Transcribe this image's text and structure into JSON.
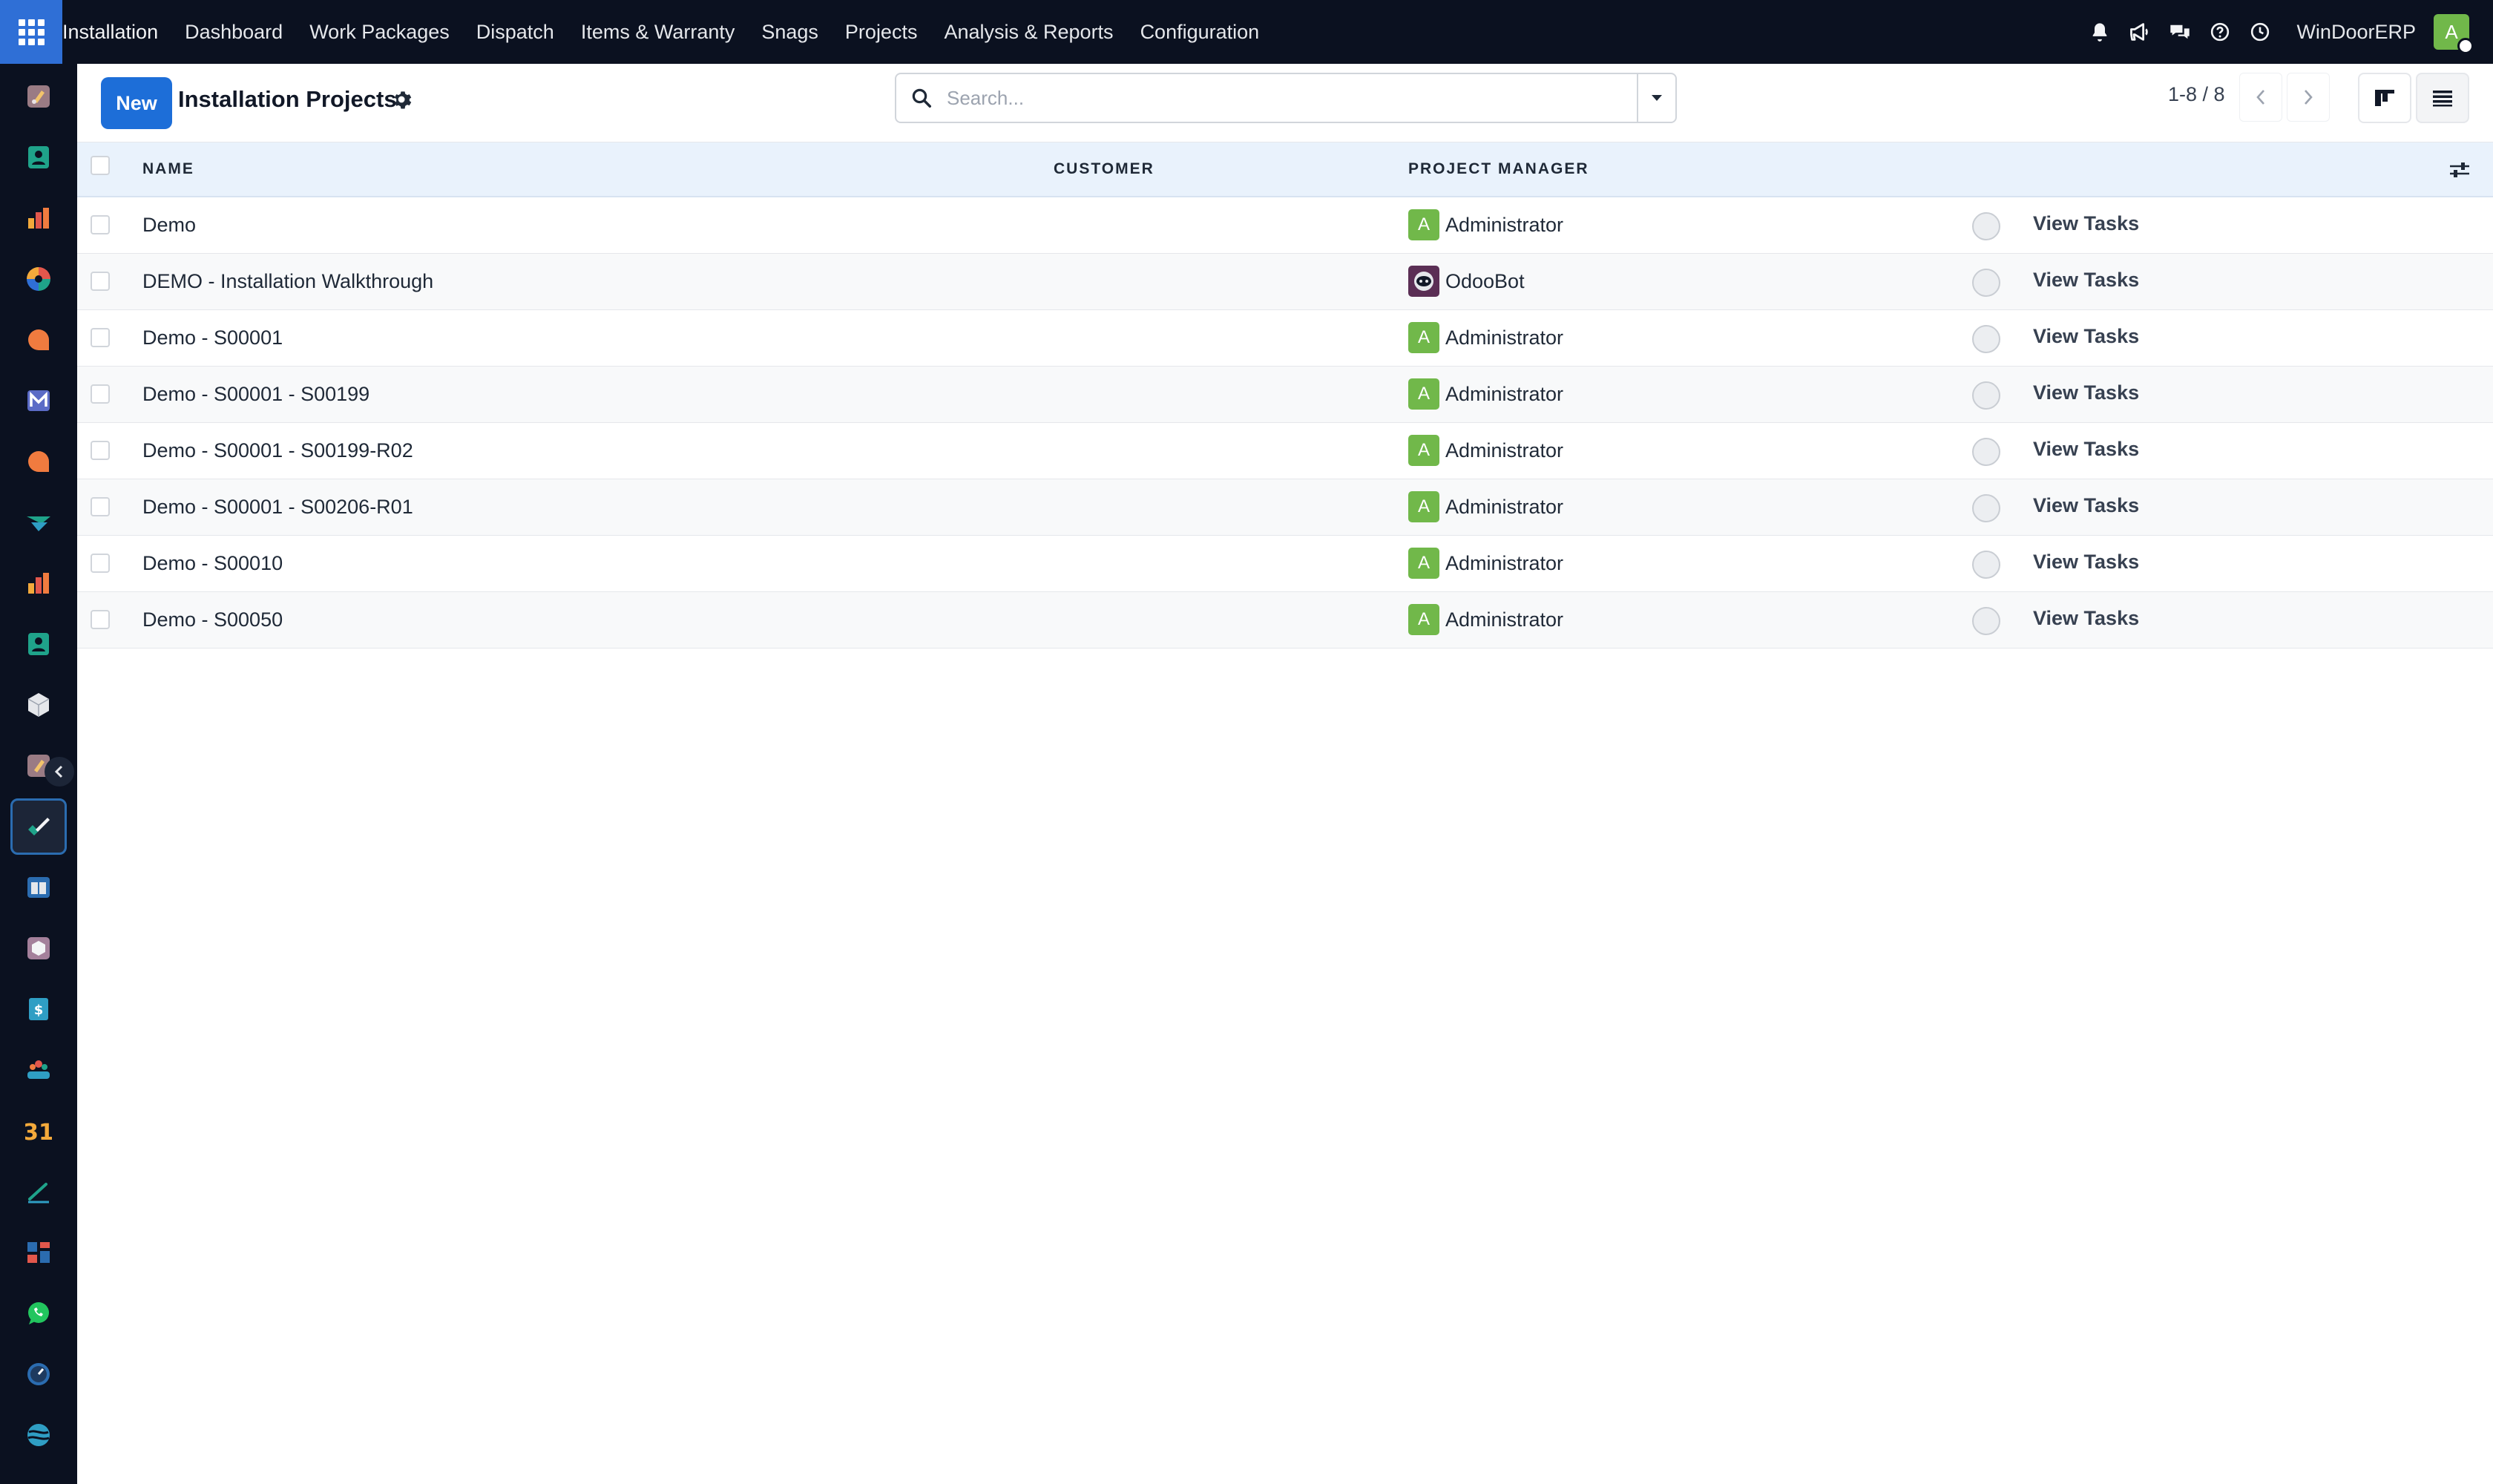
{
  "topbar": {
    "apps_icon": "apps-grid-icon",
    "menu": [
      {
        "label": "Installation",
        "brand": true
      },
      {
        "label": "Dashboard"
      },
      {
        "label": "Work Packages"
      },
      {
        "label": "Dispatch"
      },
      {
        "label": "Items & Warranty"
      },
      {
        "label": "Snags"
      },
      {
        "label": "Projects"
      },
      {
        "label": "Analysis & Reports"
      },
      {
        "label": "Configuration"
      }
    ],
    "tray_icons": [
      "bell-icon",
      "megaphone-icon",
      "chat-icon",
      "help-icon",
      "clock-icon"
    ],
    "company": "WinDoorERP",
    "user_initial": "A",
    "user_color": "#71b84a"
  },
  "rail": {
    "items": [
      "discuss-app-icon",
      "contacts-app-icon",
      "sales-app-icon",
      "crm-app-icon",
      "livechat-app-icon",
      "email-marketing-app-icon",
      "chat-app-icon",
      "planning-app-icon",
      "reports-app-icon",
      "employees-app-icon",
      "inventory-app-icon",
      "field-service-app-icon",
      "installation-app-icon",
      "knowledge-app-icon",
      "product-app-icon",
      "accounting-app-icon",
      "team-app-icon",
      "calendar-app-icon",
      "sign-app-icon",
      "dashboard-app-icon",
      "whatsapp-app-icon",
      "timer-app-icon",
      "website-app-icon"
    ],
    "active_index": 12,
    "calendar_label": "31"
  },
  "control_panel": {
    "new_label": "New",
    "title": "Installation Projects",
    "search_placeholder": "Search...",
    "pager": "1-8 / 8"
  },
  "list": {
    "columns": {
      "name": "NAME",
      "customer": "CUSTOMER",
      "project_manager": "PROJECT MANAGER"
    },
    "rows": [
      {
        "name": "Demo",
        "customer": "",
        "manager": "Administrator",
        "manager_initial": "A",
        "manager_is_bot": false,
        "action": "View Tasks"
      },
      {
        "name": "DEMO - Installation Walkthrough",
        "customer": "",
        "manager": "OdooBot",
        "manager_initial": "",
        "manager_is_bot": true,
        "action": "View Tasks"
      },
      {
        "name": "Demo - S00001",
        "customer": "",
        "manager": "Administrator",
        "manager_initial": "A",
        "manager_is_bot": false,
        "action": "View Tasks"
      },
      {
        "name": "Demo - S00001 - S00199",
        "customer": "",
        "manager": "Administrator",
        "manager_initial": "A",
        "manager_is_bot": false,
        "action": "View Tasks"
      },
      {
        "name": "Demo - S00001 - S00199-R02",
        "customer": "",
        "manager": "Administrator",
        "manager_initial": "A",
        "manager_is_bot": false,
        "action": "View Tasks"
      },
      {
        "name": "Demo - S00001 - S00206-R01",
        "customer": "",
        "manager": "Administrator",
        "manager_initial": "A",
        "manager_is_bot": false,
        "action": "View Tasks"
      },
      {
        "name": "Demo - S00010",
        "customer": "",
        "manager": "Administrator",
        "manager_initial": "A",
        "manager_is_bot": false,
        "action": "View Tasks"
      },
      {
        "name": "Demo - S00050",
        "customer": "",
        "manager": "Administrator",
        "manager_initial": "A",
        "manager_is_bot": false,
        "action": "View Tasks"
      }
    ]
  }
}
